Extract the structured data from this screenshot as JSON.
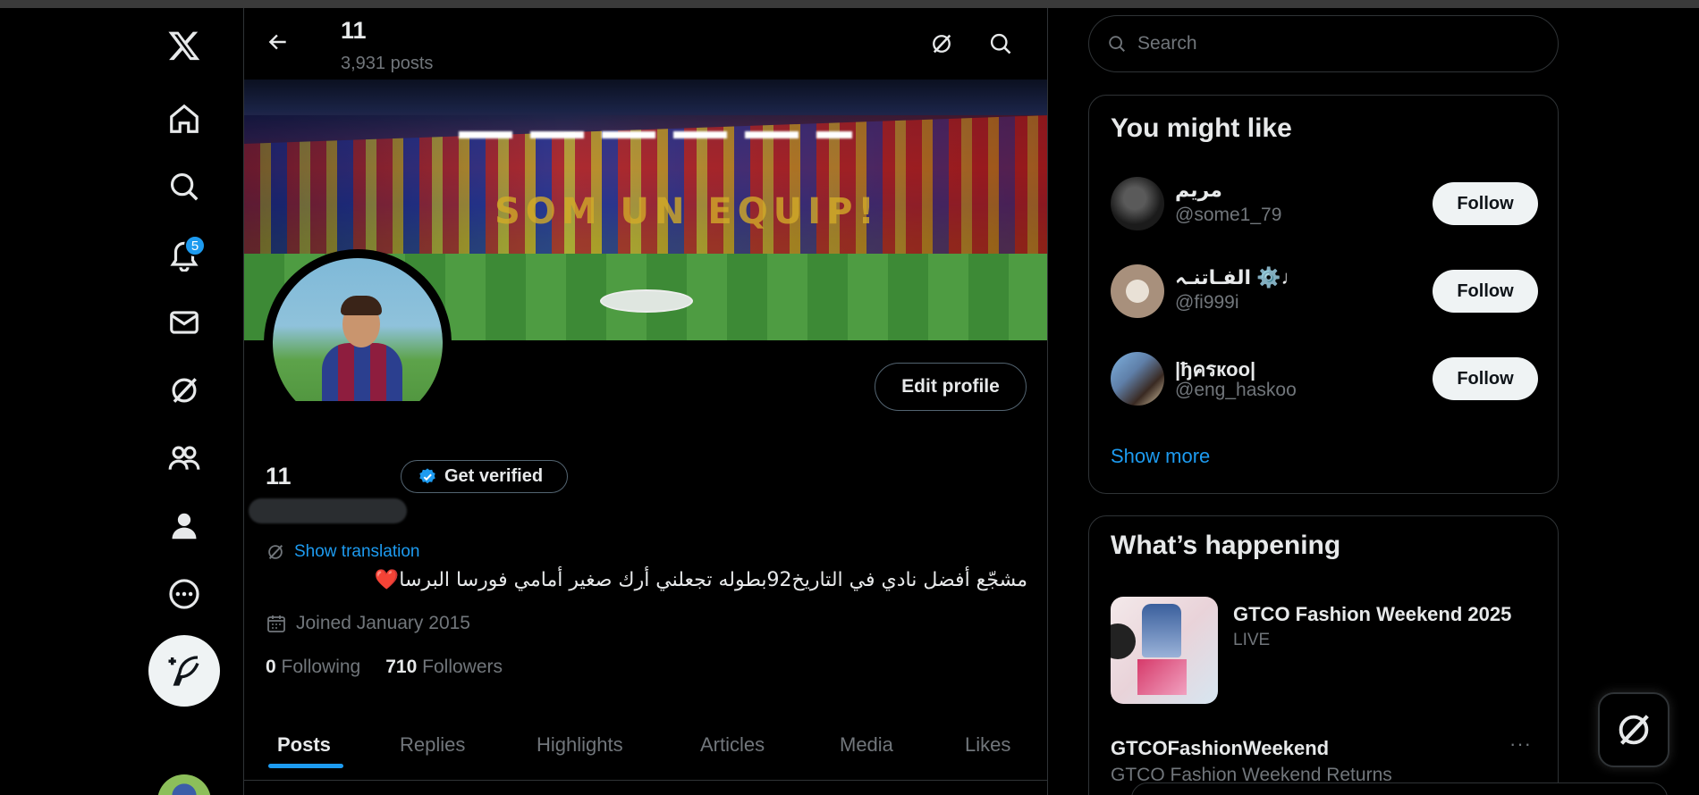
{
  "nav": {
    "logo": "x-logo-icon",
    "notifications_badge": "5",
    "items": [
      "home-icon",
      "explore-icon",
      "notifications-icon",
      "messages-icon",
      "grok-icon",
      "communities-icon",
      "profile-icon",
      "more-icon"
    ]
  },
  "header": {
    "name": "11",
    "posts_count": "3,931 posts"
  },
  "profile": {
    "display_name": "11",
    "get_verified": "Get verified",
    "edit_profile": "Edit profile",
    "show_translation": "Show translation",
    "bio": "مشجّع أفضل نادي في التاريخ92بطوله تجعلني أرك صغير أمامي فورسا البرسا❤️",
    "joined": "Joined January 2015",
    "following_count": "0",
    "following_label": "Following",
    "followers_count": "710",
    "followers_label": "Followers",
    "banner_text": "SOM UN EQUIP!"
  },
  "tabs": [
    "Posts",
    "Replies",
    "Highlights",
    "Articles",
    "Media",
    "Likes"
  ],
  "search": {
    "placeholder": "Search"
  },
  "who_to_follow": {
    "title": "You might like",
    "users": [
      {
        "name": "مريم",
        "handle": "@some1_79",
        "button": "Follow"
      },
      {
        "name": "الفـاتنـہ ⚙️♩",
        "handle": "@fi999i",
        "button": "Follow"
      },
      {
        "name": "|ђครкoo|",
        "handle": "@eng_haskoo",
        "button": "Follow"
      }
    ],
    "show_more": "Show more"
  },
  "trending": {
    "title": "What’s happening",
    "items": [
      {
        "title": "GTCO Fashion Weekend 2025",
        "meta": "LIVE"
      },
      {
        "title": "GTCOFashionWeekend",
        "meta": "GTCO Fashion Weekend Returns",
        "more": "···"
      }
    ]
  },
  "colors": {
    "accent": "#1d9bf0",
    "background": "#000000",
    "border": "#2f3336",
    "muted": "#71767b"
  }
}
